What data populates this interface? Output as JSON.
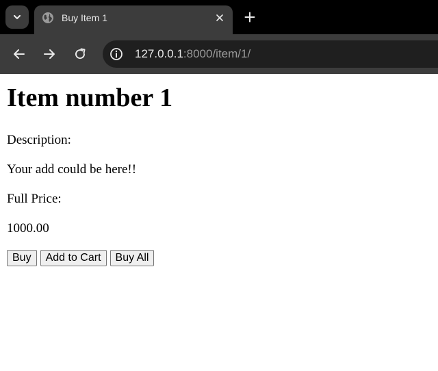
{
  "browser": {
    "tab_title": "Buy Item 1",
    "url_host": "127.0.0.1",
    "url_rest": ":8000/item/1/",
    "icons": {
      "tab_search": "chevron-down-icon",
      "favicon": "globe-icon",
      "tab_close": "close-icon",
      "new_tab": "plus-icon",
      "back": "arrow-left-icon",
      "forward": "arrow-right-icon",
      "reload": "reload-icon",
      "site_info": "info-icon"
    }
  },
  "page": {
    "heading": "Item number 1",
    "description_label": "Description:",
    "description": "Your add could be here!!",
    "price_label": "Full Price:",
    "price": "1000.00",
    "buttons": {
      "buy": "Buy",
      "add_to_cart": "Add to Cart",
      "buy_all": "Buy All"
    }
  },
  "colors": {
    "tabstrip": "#000000",
    "toolbar": "#3c3c3c",
    "omnibox": "#1f1f1f",
    "url_host": "#e8e8e8",
    "url_rest": "#9a9a9a"
  }
}
